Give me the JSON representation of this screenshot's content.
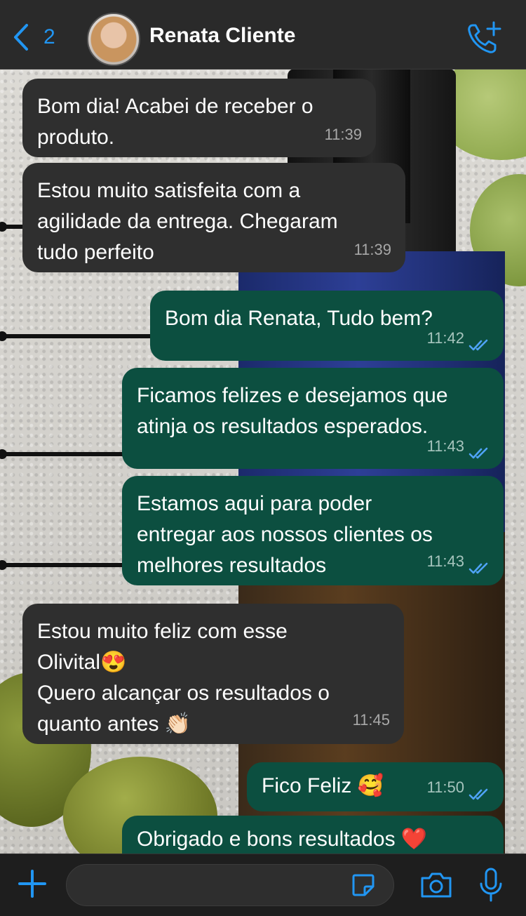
{
  "header": {
    "back_count": "2",
    "contact_name": "Renata Cliente"
  },
  "messages": [
    {
      "dir": "in",
      "lines": [
        "Bom dia! Acabei de receber o",
        "produto."
      ],
      "time": "11:39"
    },
    {
      "dir": "in",
      "lines": [
        "Estou muito satisfeita com a",
        "agilidade da entrega. Chegaram",
        "tudo perfeito"
      ],
      "time": "11:39"
    },
    {
      "dir": "out",
      "lines": [
        "Bom dia Renata, Tudo bem?"
      ],
      "time": "11:42",
      "status": "read"
    },
    {
      "dir": "out",
      "lines": [
        "Ficamos felizes e desejamos que",
        "atinja os resultados esperados."
      ],
      "time": "11:43",
      "status": "read"
    },
    {
      "dir": "out",
      "lines": [
        "Estamos aqui para poder",
        "entregar aos nossos clientes os",
        "melhores resultados"
      ],
      "time": "11:43",
      "status": "read"
    },
    {
      "dir": "in",
      "lines": [
        "Estou muito feliz com esse",
        "Olivital😍",
        "Quero alcançar os resultados o",
        "quanto antes 👏🏻"
      ],
      "time": "11:45"
    },
    {
      "dir": "out",
      "lines": [
        "Fico Feliz 🥰"
      ],
      "time": "11:50",
      "status": "read"
    },
    {
      "dir": "out",
      "lines": [
        "Obrigado e bons resultados ❤️"
      ],
      "time": "",
      "status": ""
    }
  ],
  "composer": {
    "placeholder": ""
  },
  "colors": {
    "accent": "#2196f3",
    "incoming_bubble": "#2f2f2f",
    "outgoing_bubble": "#0c4f40",
    "read_tick": "#4fa3f7"
  }
}
